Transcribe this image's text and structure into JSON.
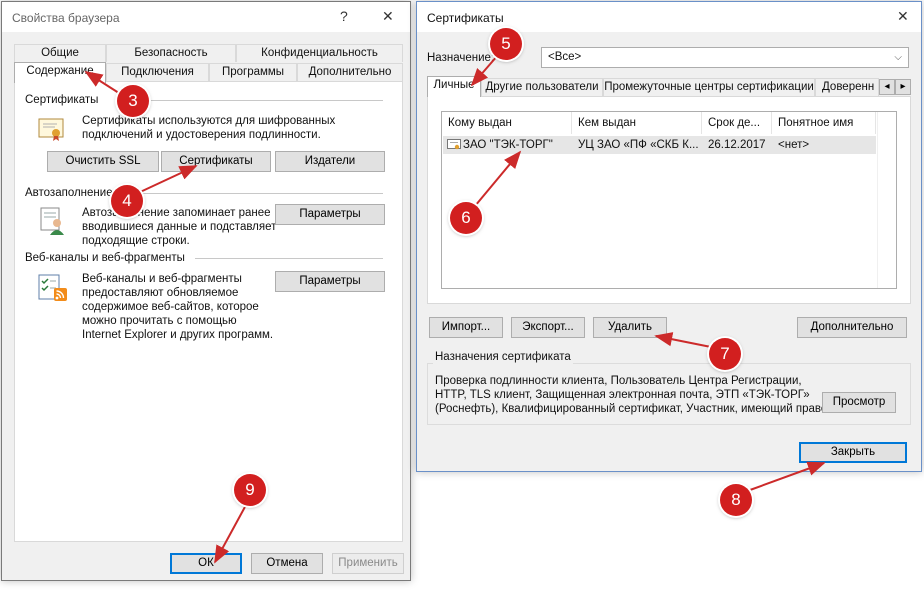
{
  "browser_props": {
    "title": "Свойства браузера",
    "help_glyph": "?",
    "close_glyph": "✕",
    "tabs_row1": [
      "Общие",
      "Безопасность",
      "Конфиденциальность"
    ],
    "tabs_row2": [
      "Содержание",
      "Подключения",
      "Программы",
      "Дополнительно"
    ],
    "certs": {
      "heading": "Сертификаты",
      "description": [
        "Сертификаты используются для шифрованных",
        "подключений и удостоверения подлинности."
      ],
      "clear_ssl": "Очистить SSL",
      "certificates": "Сертификаты",
      "publishers": "Издатели"
    },
    "autocomplete": {
      "heading": "Автозаполнение",
      "description": [
        "Автозаполнение запоминает ранее",
        "вводившиеся данные и подставляет",
        "подходящие строки."
      ],
      "settings": "Параметры"
    },
    "feeds": {
      "heading": "Веб-каналы и веб-фрагменты",
      "description": [
        "Веб-каналы и веб-фрагменты",
        "предоставляют обновляемое",
        "содержимое веб-сайтов, которое",
        "можно прочитать с помощью",
        "Internet Explorer и других программ."
      ],
      "settings": "Параметры"
    },
    "ok": "ОК",
    "cancel": "Отмена",
    "apply": "Применить"
  },
  "certificates_dialog": {
    "title": "Сертификаты",
    "close_glyph": "✕",
    "purpose_label": "Назначение:",
    "purpose_value": "<Все>",
    "tabs": [
      "Личные",
      "Другие пользователи",
      "Промежуточные центры сертификации",
      "Доверенн"
    ],
    "tab_scroll_left": "◂",
    "tab_scroll_right": "▸",
    "columns": [
      "Кому выдан",
      "Кем выдан",
      "Срок де...",
      "Понятное имя"
    ],
    "rows": [
      {
        "issued_to": "ЗАО \"ТЭК-ТОРГ\"",
        "issued_by": "УЦ ЗАО «ПФ «СКБ К...",
        "expires": "26.12.2017",
        "friendly_name": "<нет>"
      }
    ],
    "import": "Импорт...",
    "export": "Экспорт...",
    "remove": "Удалить",
    "advanced": "Дополнительно",
    "purposes_group": "Назначения сертификата",
    "purposes_text": [
      "Проверка подлинности клиента, Пользователь Центра Регистрации,",
      "HTTP, TLS клиент, Защищенная электронная почта, ЭТП «ТЭК-ТОРГ»",
      "(Роснефть), Квалифицированный сертификат, Участник, имеющий право"
    ],
    "view": "Просмотр",
    "close": "Закрыть"
  },
  "markers": [
    "3",
    "4",
    "5",
    "6",
    "7",
    "8",
    "9"
  ],
  "colors": {
    "marker": "#d21f1f",
    "arrow": "#cc2a2a",
    "accent": "#0078d7"
  }
}
